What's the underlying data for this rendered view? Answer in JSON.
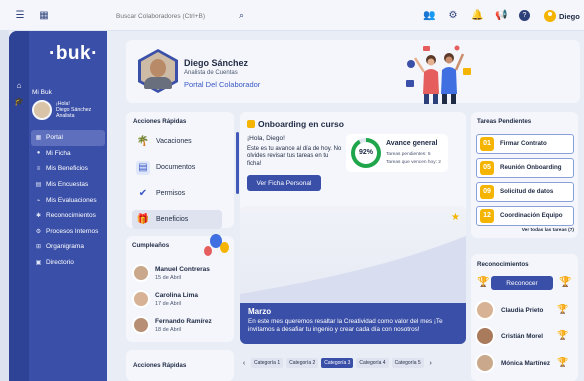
{
  "topbar": {
    "search_placeholder": "Buscar Colaboradores (Ctrl+B)",
    "user_name": "Diego",
    "icons": [
      "menu-icon",
      "calendar-icon",
      "search-icon",
      "people-icon",
      "gear-icon",
      "bell-icon",
      "megaphone-icon",
      "help-icon",
      "user-avatar"
    ]
  },
  "sidebar": {
    "logo": "·buk·",
    "mi_buk": "Mi Buk",
    "profile": {
      "greeting": "¡Hola!",
      "name": "Diego Sánchez",
      "role": "Analista"
    },
    "items": [
      {
        "label": "Portal",
        "icon": "grid-icon",
        "active": true
      },
      {
        "label": "Mi Ficha",
        "icon": "user-icon"
      },
      {
        "label": "Mis Beneficios",
        "icon": "list-icon"
      },
      {
        "label": "Mis Encuestas",
        "icon": "survey-icon"
      },
      {
        "label": "Mis Evaluaciones",
        "icon": "chart-icon"
      },
      {
        "label": "Reconocimientos",
        "icon": "badge-icon"
      },
      {
        "label": "Procesos Internos",
        "icon": "process-icon"
      },
      {
        "label": "Organigrama",
        "icon": "org-icon"
      },
      {
        "label": "Directorio",
        "icon": "directory-icon"
      }
    ]
  },
  "header": {
    "name": "Diego Sánchez",
    "role": "Analista de Cuentas",
    "portal": "Portal Del Colaborador"
  },
  "acciones": {
    "title": "Acciones Rápidas",
    "items": [
      "Vacaciones",
      "Documentos",
      "Permisos",
      "Beneficios"
    ],
    "selected_index": 3
  },
  "cumpleanos": {
    "title": "Cumpleaños",
    "people": [
      {
        "name": "Manuel Contreras",
        "date": "15 de Abril"
      },
      {
        "name": "Carolina Lima",
        "date": "17 de Abril"
      },
      {
        "name": "Fernando Ramírez",
        "date": "18 de Abril"
      }
    ]
  },
  "acciones2": {
    "title": "Acciones Rápidas"
  },
  "onboarding": {
    "title": "Onboarding en curso",
    "greeting": "¡Hola, Diego!",
    "text": "Este es tu avance al día de hoy. No olvides revisar tus tareas en tu ficha!",
    "button": "Ver Ficha Personal",
    "avance": {
      "title": "Avance general",
      "percent_label": "92%",
      "percent": 0.92,
      "pending": "Tareas pendientes: 5",
      "due_today": "Tareas que vencen hoy: 2"
    }
  },
  "marzo": {
    "title": "Marzo",
    "text": "En este mes queremos resaltar la Creatividad como valor del mes ¡Te invitamos a desafiar tu ingenio y crear cada día con nosotros!"
  },
  "categorias": {
    "prev": "‹",
    "next": "›",
    "items": [
      "Categoría 1",
      "Categoría 2",
      "Categoría 3",
      "Categoría 4",
      "Categoría 5"
    ],
    "active_index": 2
  },
  "tareas": {
    "title": "Tareas Pendientes",
    "items": [
      {
        "num": "01",
        "label": "Firmar Contrato"
      },
      {
        "num": "05",
        "label": "Reunión Onboarding"
      },
      {
        "num": "09",
        "label": "Solicitud de datos"
      },
      {
        "num": "12",
        "label": "Coordinación Equipo"
      }
    ],
    "link": "Ver todas las tareas (7)"
  },
  "reconocimientos": {
    "title": "Reconocimientos",
    "button": "Reconocer",
    "people": [
      {
        "name": "Claudia Prieto"
      },
      {
        "name": "Cristián Morel"
      },
      {
        "name": "Mónica Martínez"
      }
    ]
  },
  "colors": {
    "primary": "#3a4fa8",
    "accent": "#f5b400",
    "progress": "#1fa64a"
  }
}
